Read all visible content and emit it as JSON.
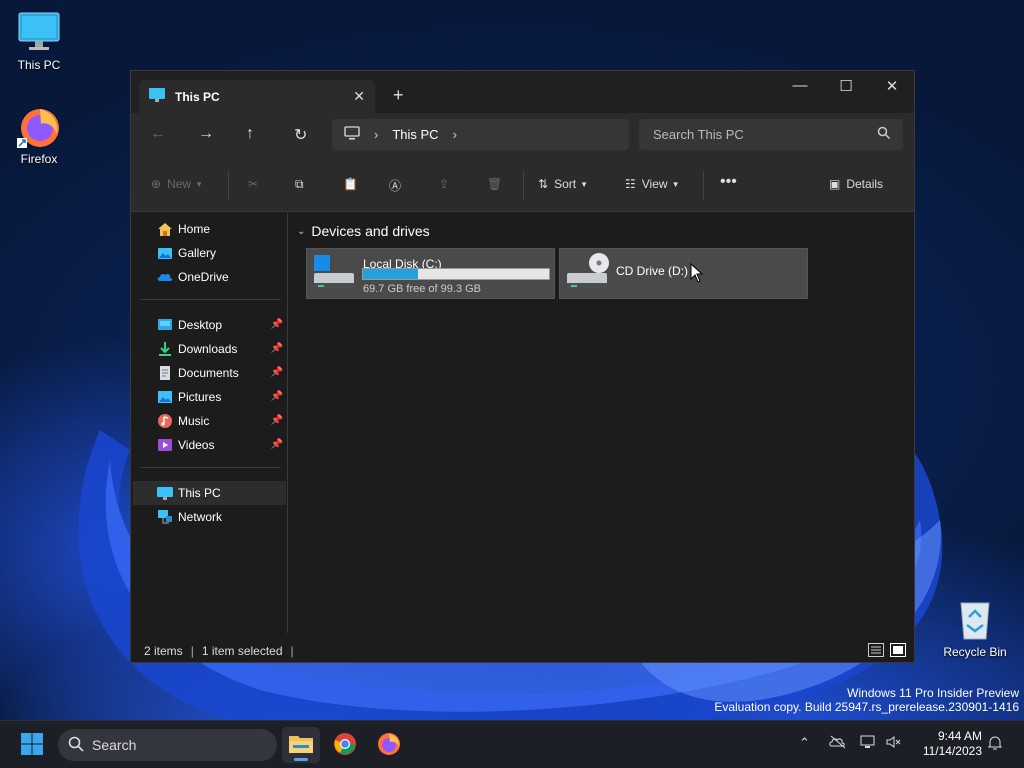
{
  "desktop": {
    "icons": [
      {
        "label": "This PC"
      },
      {
        "label": "Firefox"
      },
      {
        "label": "Recycle Bin"
      }
    ]
  },
  "window": {
    "tab_title": "This PC",
    "breadcrumb": {
      "label": "This PC"
    },
    "search": {
      "placeholder": "Search This PC"
    },
    "commands": {
      "new_label": "New",
      "sort_label": "Sort",
      "view_label": "View",
      "details_label": "Details"
    },
    "nav": {
      "quick": [
        {
          "label": "Home",
          "icon": "home-icon"
        },
        {
          "label": "Gallery",
          "icon": "gallery-icon"
        },
        {
          "label": "OneDrive",
          "icon": "onedrive-icon"
        }
      ],
      "pinned": [
        {
          "label": "Desktop",
          "icon": "desktop-folder-icon"
        },
        {
          "label": "Downloads",
          "icon": "downloads-folder-icon"
        },
        {
          "label": "Documents",
          "icon": "documents-folder-icon"
        },
        {
          "label": "Pictures",
          "icon": "pictures-folder-icon"
        },
        {
          "label": "Music",
          "icon": "music-folder-icon"
        },
        {
          "label": "Videos",
          "icon": "videos-folder-icon"
        }
      ],
      "locations": [
        {
          "label": "This PC",
          "icon": "this-pc-icon"
        },
        {
          "label": "Network",
          "icon": "network-icon"
        }
      ]
    },
    "content": {
      "group_title": "Devices and drives",
      "drives": [
        {
          "name": "Local Disk (C:)",
          "free_text": "69.7 GB free of 99.3 GB",
          "used_fraction": 0.298
        },
        {
          "name": "CD Drive (D:)"
        }
      ]
    },
    "status": {
      "items_count": "2 items",
      "selected": "1 item selected"
    }
  },
  "taskbar": {
    "search_label": "Search",
    "time": "9:44 AM",
    "date": "11/14/2023"
  },
  "watermark": {
    "line1": "Windows 11 Pro Insider Preview",
    "line2": "Evaluation copy. Build 25947.rs_prerelease.230901-1416"
  },
  "colors": {
    "accent": "#26a0da",
    "window_bg": "#1c1c1c"
  }
}
